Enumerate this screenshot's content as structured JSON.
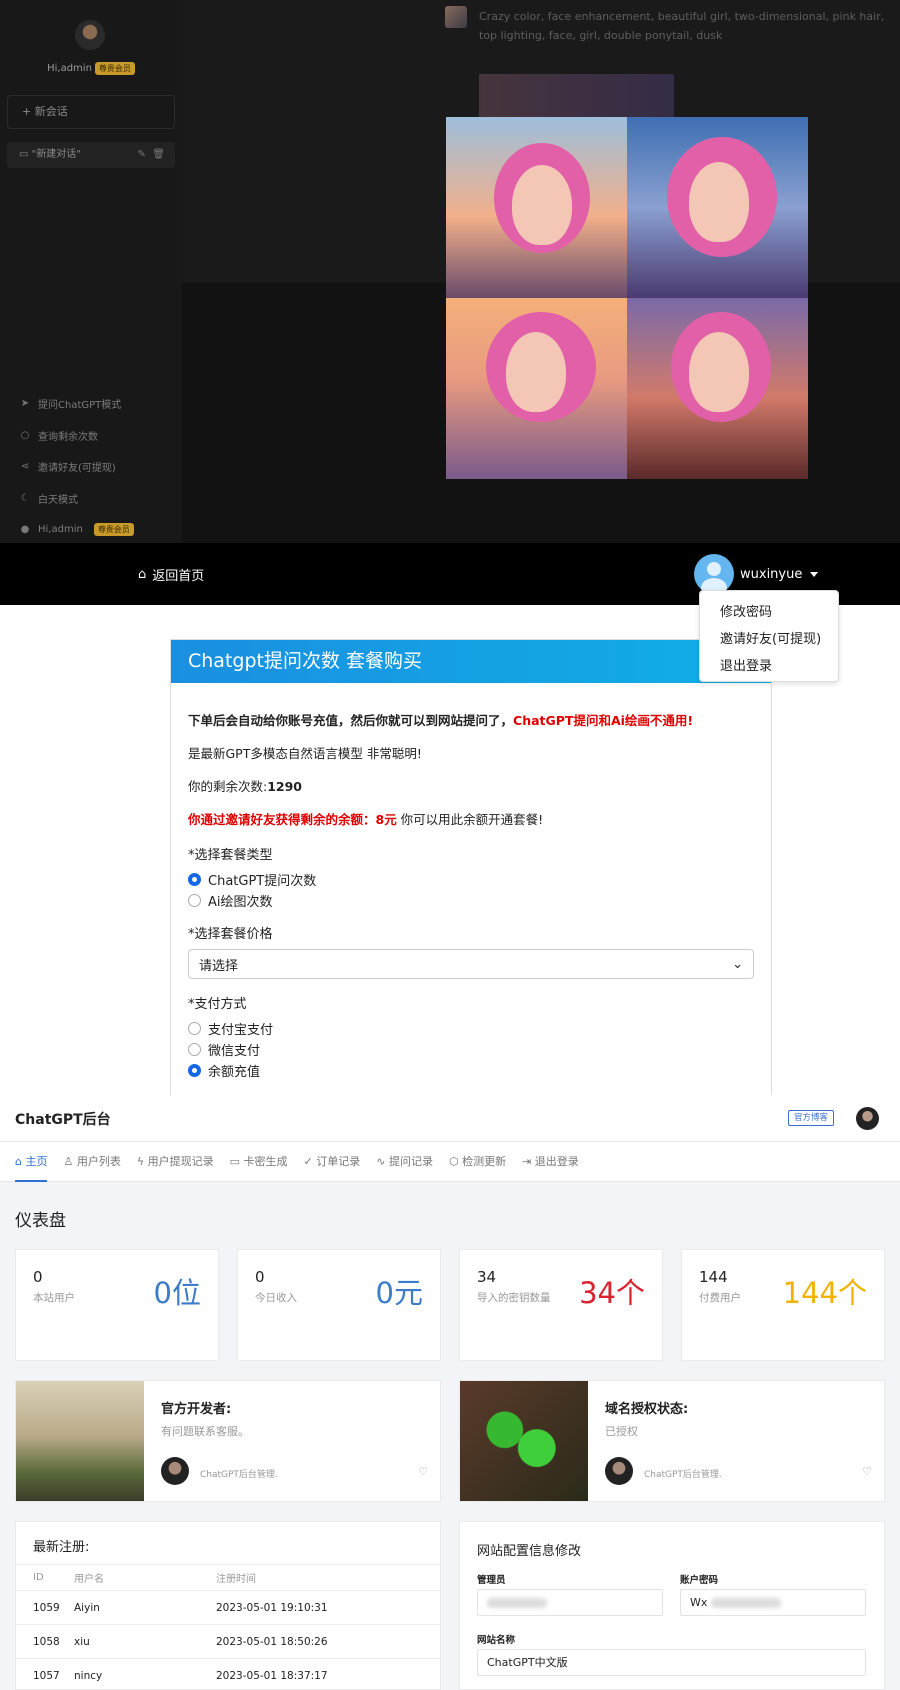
{
  "chat_sidebar": {
    "greeting": "Hi,admin",
    "vip_badge": "尊贵会员",
    "new_chat": "新会话",
    "conversation": "\"新建对话\"",
    "menu": [
      {
        "icon": "send-icon",
        "label": "提问ChatGPT模式"
      },
      {
        "icon": "search-icon",
        "label": "查询剩余次数"
      },
      {
        "icon": "share-icon",
        "label": "邀请好友(可提现)"
      },
      {
        "icon": "moon-icon",
        "label": "白天模式"
      },
      {
        "icon": "user-icon",
        "label": "Hi,admin"
      }
    ],
    "footer_badge": "尊贵会员"
  },
  "chat": {
    "prompt": "Crazy color, face enhancement, beautiful girl, two-dimensional, pink hair, top lighting, face, girl, double ponytail, dusk"
  },
  "purchase": {
    "nav_home": "返回首页",
    "username": "wuxinyue",
    "dropdown": [
      "修改密码",
      "邀请好友(可提现)",
      "退出登录"
    ],
    "card_title": "Chatgpt提问次数 套餐购买",
    "notice_main": "下单后会自动给你账号充值，然后你就可以到网站提问了，",
    "notice_red": "ChatGPT提问和Ai绘画不通用!",
    "model_desc": "是最新GPT多模态自然语言模型 非常聪明!",
    "remaining_label": "你的剩余次数:",
    "remaining_value": "1290",
    "balance_red": "你通过邀请好友获得剩余的余额：8元",
    "balance_tail": " 你可以用此余额开通套餐!",
    "type_label": "*选择套餐类型",
    "type_options": [
      "ChatGPT提问次数",
      "Ai绘图次数"
    ],
    "type_selected": 0,
    "price_label": "*选择套餐价格",
    "price_placeholder": "请选择",
    "pay_label": "*支付方式",
    "pay_options": [
      "支付宝支付",
      "微信支付",
      "余额充值"
    ],
    "pay_selected": 2
  },
  "admin": {
    "title": "ChatGPT后台",
    "blog_button": "官方博客",
    "tabs": [
      "主页",
      "用户列表",
      "用户提现记录",
      "卡密生成",
      "订单记录",
      "提问记录",
      "检测更新",
      "退出登录"
    ],
    "tab_icons": [
      "home-icon",
      "user-icon",
      "bolt-icon",
      "card-icon",
      "check-icon",
      "pulse-icon",
      "box-icon",
      "logout-icon"
    ],
    "active_tab": 0,
    "dashboard_title": "仪表盘",
    "stats": [
      {
        "value": "0",
        "label": "本站用户",
        "big": "0位",
        "color": "#3d7cc9"
      },
      {
        "value": "0",
        "label": "今日收入",
        "big": "0元",
        "color": "#3d7cc9"
      },
      {
        "value": "34",
        "label": "导入的密钥数量",
        "big": "34个",
        "color": "#d9232e"
      },
      {
        "value": "144",
        "label": "付费用户",
        "big": "144个",
        "color": "#f0b400"
      }
    ],
    "info_cards": [
      {
        "title": "官方开发者:",
        "subtitle": "有问题联系客服。",
        "author": "ChatGPT后台管理."
      },
      {
        "title": "域名授权状态:",
        "subtitle": "已授权",
        "author": "ChatGPT后台管理."
      }
    ],
    "recent_title": "最新注册:",
    "recent_headers": [
      "ID",
      "用户名",
      "注册时间"
    ],
    "recent_rows": [
      [
        "1059",
        "Aiyin",
        "2023-05-01 19:10:31"
      ],
      [
        "1058",
        "xiu",
        "2023-05-01 18:50:26"
      ],
      [
        "1057",
        "nincy",
        "2023-05-01 18:37:17"
      ]
    ],
    "config_title": "网站配置信息修改",
    "config_admin_label": "管理员",
    "config_password_label": "账户密码",
    "config_password_value": "Wx",
    "config_sitename_label": "网站名称",
    "config_sitename_value": "ChatGPT中文版"
  }
}
